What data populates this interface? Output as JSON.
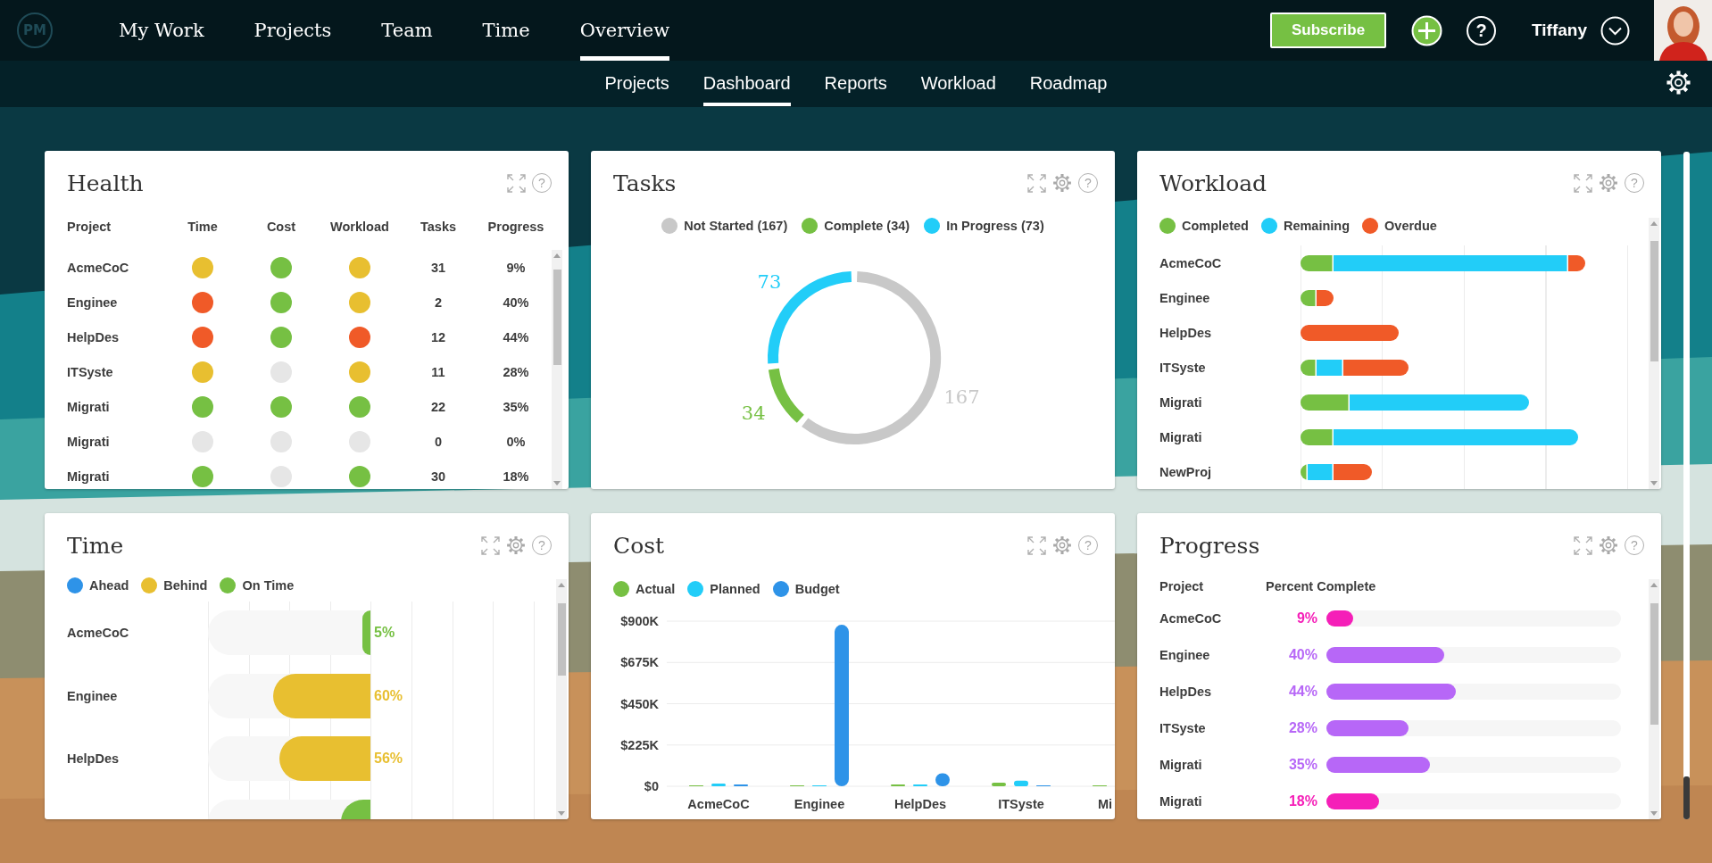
{
  "top_nav": {
    "logo": "PM",
    "tabs": [
      {
        "label": "My Work",
        "selected": false
      },
      {
        "label": "Projects",
        "selected": false
      },
      {
        "label": "Team",
        "selected": false
      },
      {
        "label": "Time",
        "selected": false
      },
      {
        "label": "Overview",
        "selected": true
      }
    ],
    "subscribe": "Subscribe",
    "help": "?",
    "user": "Tiffany"
  },
  "sub_nav": {
    "tabs": [
      {
        "label": "Projects",
        "selected": false
      },
      {
        "label": "Dashboard",
        "selected": true
      },
      {
        "label": "Reports",
        "selected": false
      },
      {
        "label": "Workload",
        "selected": false
      },
      {
        "label": "Roadmap",
        "selected": false
      }
    ]
  },
  "health": {
    "title": "Health",
    "tools": [
      {
        "kind": "expand"
      },
      {
        "kind": "help",
        "glyph": "?"
      }
    ],
    "columns": [
      "Project",
      "Time",
      "Cost",
      "Workload",
      "Tasks",
      "Progress"
    ],
    "rows": [
      {
        "project": "AcmeCoC",
        "time": {
          "color": "#e8bf30"
        },
        "cost": {
          "color": "#76c043"
        },
        "workload": {
          "color": "#e8bf30"
        },
        "tasks": "31",
        "progress": "9%"
      },
      {
        "project": "Enginee",
        "time": {
          "color": "#f05a28"
        },
        "cost": {
          "color": "#76c043"
        },
        "workload": {
          "color": "#e8bf30"
        },
        "tasks": "2",
        "progress": "40%"
      },
      {
        "project": "HelpDes",
        "time": {
          "color": "#f05a28"
        },
        "cost": {
          "color": "#76c043"
        },
        "workload": {
          "color": "#f05a28"
        },
        "tasks": "12",
        "progress": "44%"
      },
      {
        "project": "ITSyste",
        "time": {
          "color": "#e8bf30"
        },
        "cost": {
          "color": "#e6e6e6"
        },
        "workload": {
          "color": "#e8bf30"
        },
        "tasks": "11",
        "progress": "28%"
      },
      {
        "project": "Migrati",
        "time": {
          "color": "#76c043"
        },
        "cost": {
          "color": "#76c043"
        },
        "workload": {
          "color": "#76c043"
        },
        "tasks": "22",
        "progress": "35%"
      },
      {
        "project": "Migrati",
        "time": {
          "color": "#e6e6e6"
        },
        "cost": {
          "color": "#e6e6e6"
        },
        "workload": {
          "color": "#e6e6e6"
        },
        "tasks": "0",
        "progress": "0%"
      },
      {
        "project": "Migrati",
        "time": {
          "color": "#76c043"
        },
        "cost": {
          "color": "#e6e6e6"
        },
        "workload": {
          "color": "#76c043"
        },
        "tasks": "30",
        "progress": "18%"
      }
    ]
  },
  "tasks": {
    "title": "Tasks",
    "tools": [
      {
        "kind": "expand"
      },
      {
        "kind": "settings"
      },
      {
        "kind": "help",
        "glyph": "?"
      }
    ],
    "legend": [
      {
        "label": "Not Started (167)",
        "color": "#c8c8c8"
      },
      {
        "label": "Complete (34)",
        "color": "#76c043"
      },
      {
        "label": "In Progress (73)",
        "color": "#22cdf8"
      }
    ],
    "chart_data": {
      "type": "donut",
      "values": [
        167,
        34,
        73
      ],
      "value_labels": [
        "167",
        "34",
        "73"
      ]
    }
  },
  "workload": {
    "title": "Workload",
    "tools": [
      {
        "kind": "expand"
      },
      {
        "kind": "settings"
      },
      {
        "kind": "help",
        "glyph": "?"
      }
    ],
    "legend": [
      {
        "kind": "completed",
        "label": "Completed",
        "color": "#76c043"
      },
      {
        "kind": "remaining",
        "label": "Remaining",
        "color": "#22cdf8"
      },
      {
        "kind": "overdue",
        "label": "Overdue",
        "color": "#f05a28"
      }
    ],
    "rows": [
      {
        "project": "AcmeCoC"
      },
      {
        "project": "Enginee"
      },
      {
        "project": "HelpDes"
      },
      {
        "project": "ITSyste"
      },
      {
        "project": "Migrati"
      },
      {
        "project": "Migrati"
      },
      {
        "project": "NewProj"
      }
    ]
  },
  "time": {
    "title": "Time",
    "tools": [
      {
        "kind": "expand"
      },
      {
        "kind": "settings"
      },
      {
        "kind": "help",
        "glyph": "?"
      }
    ],
    "legend": [
      {
        "kind": "ahead",
        "label": "Ahead",
        "color": "#2e93e8"
      },
      {
        "kind": "behind",
        "label": "Behind",
        "color": "#e8bf30"
      },
      {
        "kind": "on_time",
        "label": "On Time",
        "color": "#76c043"
      }
    ],
    "rows": [
      {
        "project": "AcmeCoC",
        "kind": "on_time",
        "level": 0.05,
        "reading": "5%"
      },
      {
        "project": "Enginee",
        "kind": "behind",
        "level": 0.6,
        "reading": "60%"
      },
      {
        "project": "HelpDes",
        "kind": "behind",
        "level": 0.56,
        "reading": "56%"
      },
      {
        "kind": "on_time",
        "level": 0.18
      }
    ]
  },
  "cost": {
    "title": "Cost",
    "tools": [
      {
        "kind": "expand"
      },
      {
        "kind": "settings"
      },
      {
        "kind": "help",
        "glyph": "?"
      }
    ],
    "chart_data": {
      "type": "bar",
      "categories": [
        "AcmeCoC",
        "Enginee",
        "HelpDes",
        "ITSyste",
        "Mi"
      ],
      "series": [
        {
          "name": "Actual",
          "color": "#76c043",
          "values": [
            5000,
            3000,
            10000,
            20000,
            3000
          ]
        },
        {
          "name": "Planned",
          "color": "#22cdf8",
          "values": [
            15000,
            3000,
            10000,
            30000,
            null
          ]
        },
        {
          "name": "Budget",
          "color": "#2e93e8",
          "values": [
            10000,
            880000,
            70000,
            5000,
            null
          ]
        }
      ],
      "ylim": [
        0,
        900000
      ],
      "grid": true,
      "yticks": [
        {
          "value": 0,
          "label": "$0"
        },
        {
          "value": 225000,
          "label": "$225K"
        },
        {
          "value": 450000,
          "label": "$450K"
        },
        {
          "value": 675000,
          "label": "$675K"
        },
        {
          "value": 900000,
          "label": "$900K"
        }
      ]
    }
  },
  "progress": {
    "title": "Progress",
    "tools": [
      {
        "kind": "expand"
      },
      {
        "kind": "settings"
      },
      {
        "kind": "help",
        "glyph": "?"
      }
    ],
    "columns": [
      "Project",
      "Percent Complete"
    ],
    "rows": [
      {
        "project": "AcmeCoC",
        "reading": "9%",
        "level": 0.09,
        "color": "#f51fb8"
      },
      {
        "project": "Enginee",
        "reading": "40%",
        "level": 0.4,
        "color": "#b767f7"
      },
      {
        "project": "HelpDes",
        "reading": "44%",
        "level": 0.44,
        "color": "#b767f7"
      },
      {
        "project": "ITSyste",
        "reading": "28%",
        "level": 0.28,
        "color": "#b767f7"
      },
      {
        "project": "Migrati",
        "reading": "35%",
        "level": 0.35,
        "color": "#b767f7"
      },
      {
        "project": "Migrati",
        "reading": "18%",
        "level": 0.18,
        "color": "#f51fb8"
      }
    ]
  }
}
